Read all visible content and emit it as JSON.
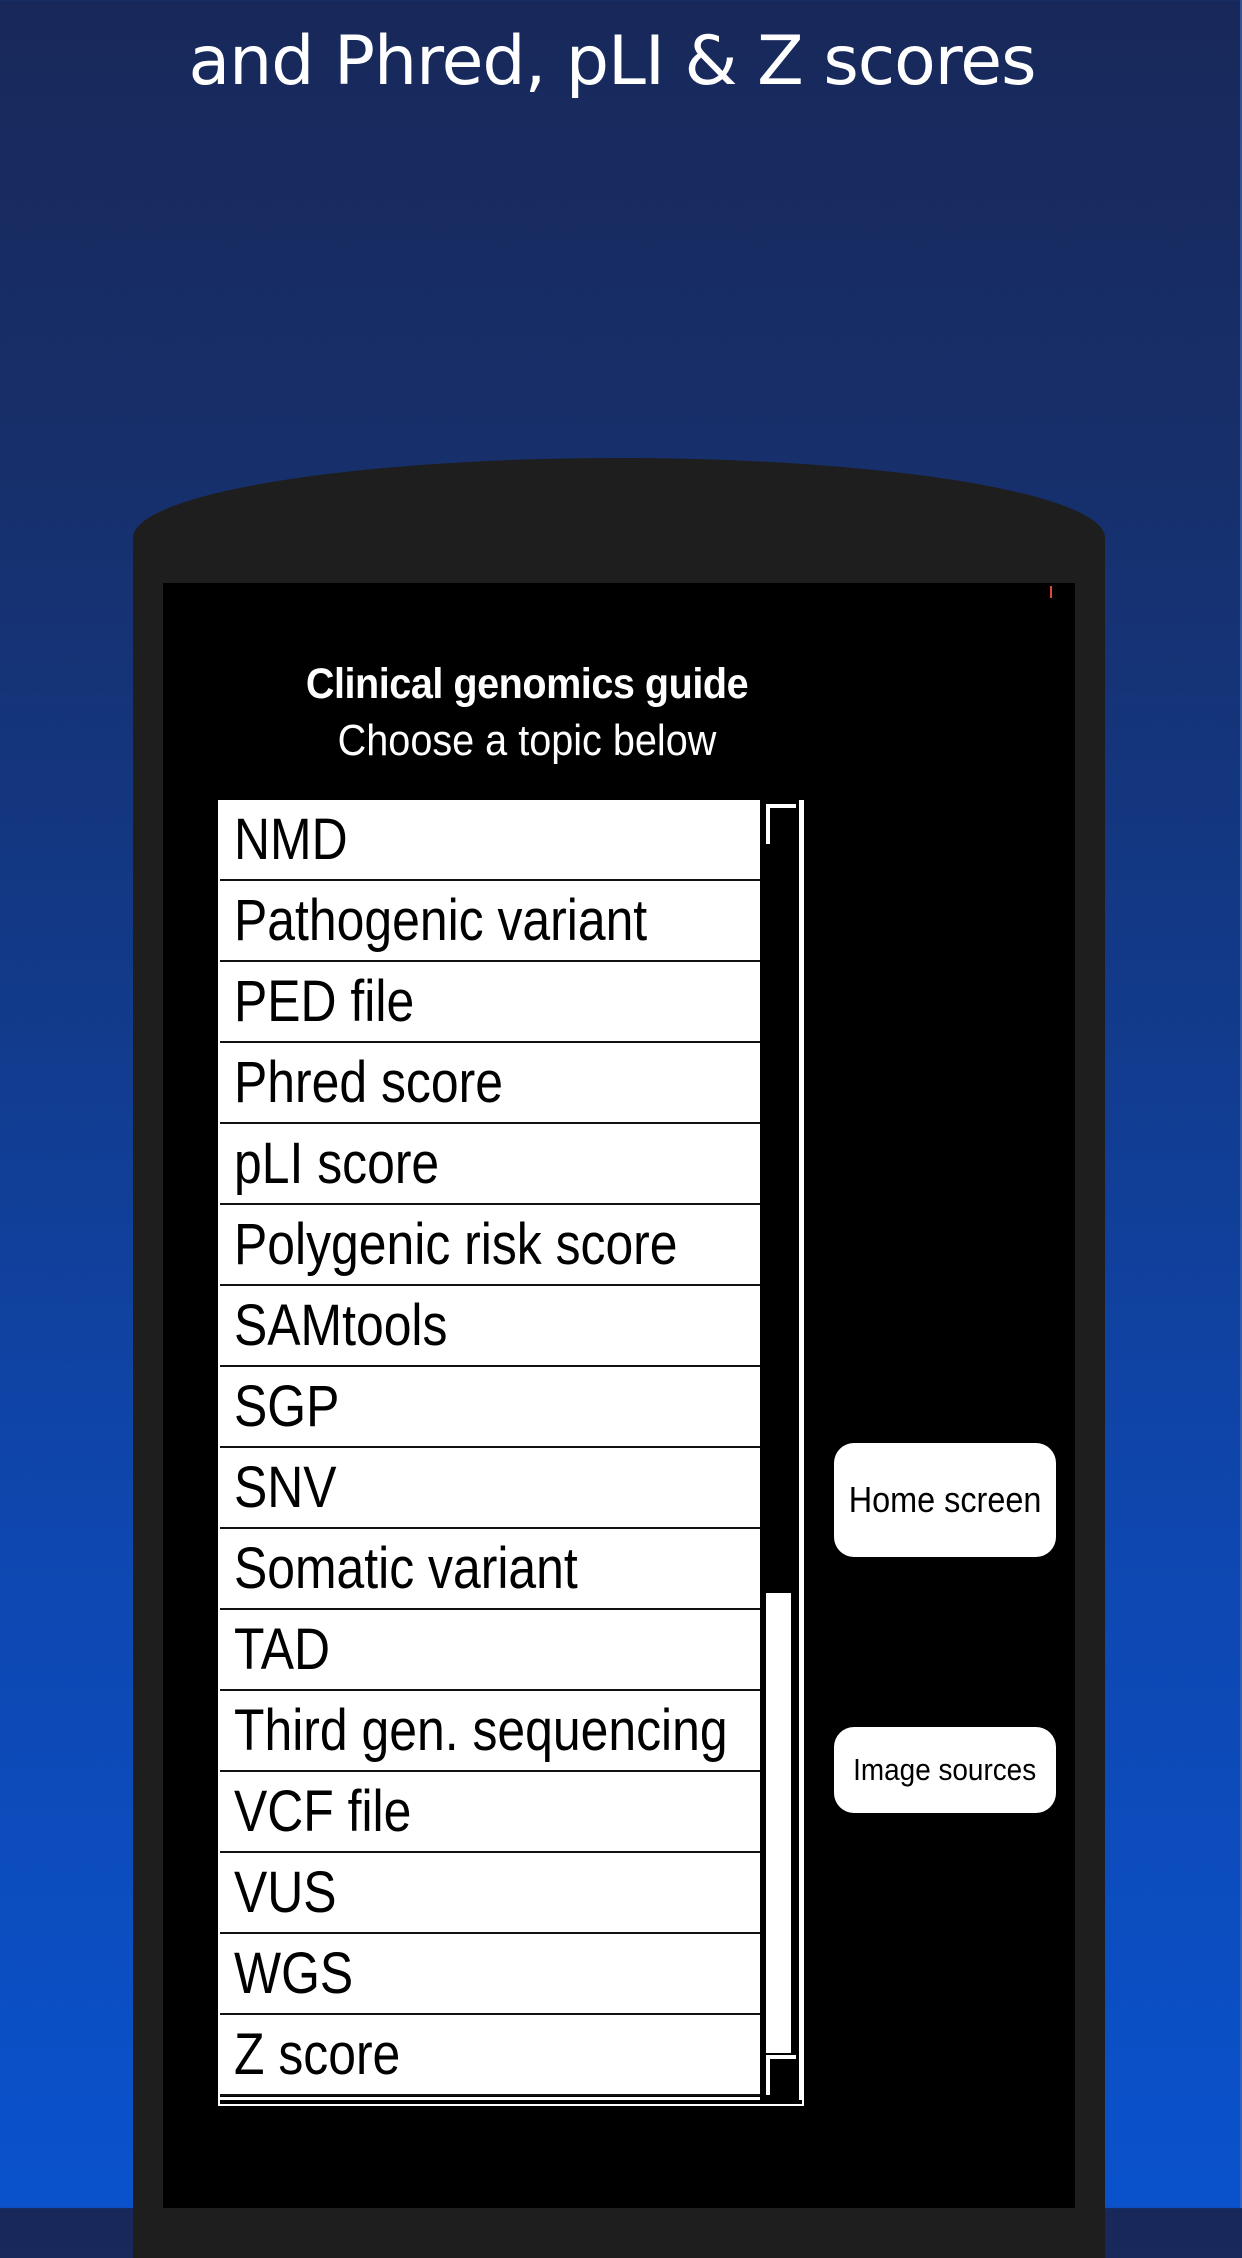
{
  "promo": {
    "title": "and Phred, pLI & Z scores"
  },
  "app": {
    "title": "Clinical genomics guide",
    "subtitle": "Choose a topic below",
    "topics": [
      "NMD",
      "Pathogenic variant",
      "PED file",
      "Phred score",
      "pLI score",
      "Polygenic risk score",
      "SAMtools",
      "SGP",
      "SNV",
      "Somatic variant",
      "TAD",
      "Third gen. sequencing",
      "VCF file",
      "VUS",
      "WGS",
      "Z score"
    ],
    "scroll_position": "end",
    "buttons": {
      "home": "Home screen",
      "sources": "Image sources"
    }
  },
  "colors": {
    "background_top": "#18285a",
    "background_bottom": "#0a52cc",
    "phone_body": "#1e1e1e",
    "screen": "#000000",
    "indicator": "#e0473a"
  }
}
